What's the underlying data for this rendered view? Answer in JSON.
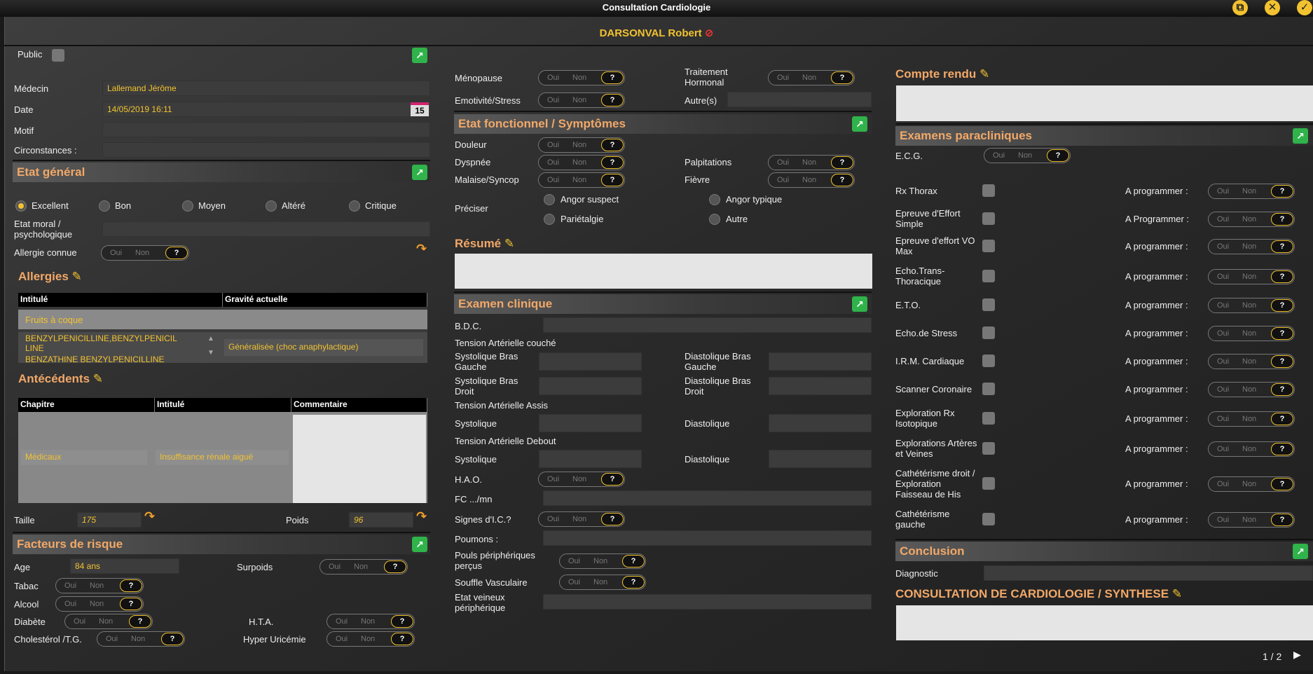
{
  "window": {
    "title": "Consultation Cardiologie",
    "page": "1 / 2"
  },
  "patient": {
    "name": "DARSONVAL Robert"
  },
  "left": {
    "public_label": "Public",
    "medecin_label": "Médecin",
    "medecin": "Lallemand Jérôme",
    "date_label": "Date",
    "date": "14/05/2019 16:11",
    "cal_day": "15",
    "motif_label": "Motif",
    "circ_label": "Circonstances :",
    "etat_general": "Etat général",
    "radios": [
      "Excellent",
      "Bon",
      "Moyen",
      "Altéré",
      "Critique"
    ],
    "etat_moral": "Etat moral / psychologique",
    "allergie_label": "Allergie connue",
    "allergies_title": "Allergies",
    "allergy_cols": [
      "Intitulé",
      "Gravité actuelle"
    ],
    "allergy_rows": [
      {
        "name": "Fruits à coque",
        "grav": ""
      },
      {
        "name": "BENZYLPENICILLINE,BENZYLPENICIL LINE",
        "grav": "Généralisée (choc anaphylactique)"
      }
    ],
    "allergy_hidden": "BENZATHINE BENZYLPENICILLINE",
    "antecedents_title": "Antécédents",
    "ante_cols": [
      "Chapitre",
      "Intitulé",
      "Commentaire"
    ],
    "ante_row": {
      "chap": "Médicaux",
      "int": "Insuffisance rénale aiguë"
    },
    "taille_label": "Taille",
    "taille": "175",
    "poids_label": "Poids",
    "poids": "96",
    "facteurs": "Facteurs de risque",
    "age_label": "Age",
    "age": "84 ans",
    "surpoids": "Surpoids",
    "tabac": "Tabac",
    "alcool": "Alcool",
    "diabete": "Diabète",
    "hta": "H.T.A.",
    "chol": "Cholestérol /T.G.",
    "hyper": "Hyper Uricémie"
  },
  "toggle": {
    "oui": "Oui",
    "non": "Non",
    "q": "?"
  },
  "middle": {
    "menopause": "Ménopause",
    "trait": "Traitement Hormonal",
    "emotivite": "Emotivité/Stress",
    "autres": "Autre(s)",
    "etat_fonc": "Etat fonctionnel / Symptômes",
    "douleur": "Douleur",
    "dyspnee": "Dyspnée",
    "palpitations": "Palpitations",
    "malaise": "Malaise/Syncop",
    "fievre": "Fièvre",
    "preciser": "Préciser",
    "angor_suspect": "Angor suspect",
    "angor_typique": "Angor typique",
    "parietalgie": "Pariétalgie",
    "autre": "Autre",
    "resume": "Résumé",
    "examen": "Examen clinique",
    "bdc": "B.D.C.",
    "ta_couche": "Tension Artérielle couché",
    "sys_g": "Systolique Bras Gauche",
    "dia_g": "Diastolique Bras Gauche",
    "sys_d": "Systolique Bras Droit",
    "dia_d": "Diastolique Bras Droit",
    "ta_assis": "Tension Artérielle Assis",
    "sys": "Systolique",
    "dia": "Diastolique",
    "ta_debout": "Tension Artérielle Debout",
    "hao": "H.A.O.",
    "fc": "FC .../mn",
    "signes": "Signes d'I.C.?",
    "poumons": "Poumons :",
    "pouls": "Pouls périphériques perçus",
    "souffle": "Souffle Vasculaire",
    "etat_veineux": "Etat veineux périphérique"
  },
  "right": {
    "compte_rendu": "Compte rendu",
    "examens": "Examens paracliniques",
    "ecg": "E.C.G.",
    "items": [
      {
        "name": "Rx Thorax",
        "prog": "A programmer :"
      },
      {
        "name": "Epreuve d'Effort Simple",
        "prog": "A Programmer :"
      },
      {
        "name": "Epreuve d'effort VO Max",
        "prog": "A programmer :"
      },
      {
        "name": "Echo.Trans-Thoracique",
        "prog": "A programmer :"
      },
      {
        "name": "E.T.O.",
        "prog": "A programmer :"
      },
      {
        "name": "Echo.de Stress",
        "prog": "A programmer :"
      },
      {
        "name": "I.R.M. Cardiaque",
        "prog": "A programmer :"
      },
      {
        "name": "Scanner Coronaire",
        "prog": "A programmer :"
      },
      {
        "name": "Exploration Rx Isotopique",
        "prog": "A programmer :"
      },
      {
        "name": "Explorations Artères et Veines",
        "prog": "A programmer :"
      },
      {
        "name": "Cathétérisme droit / Exploration Faisseau de His",
        "prog": "A programmer :"
      },
      {
        "name": "Cathétérisme gauche",
        "prog": "A programmer :"
      }
    ],
    "conclusion": "Conclusion",
    "diagnostic": "Diagnostic",
    "synthese": "CONSULTATION DE CARDIOLOGIE / SYNTHESE"
  }
}
